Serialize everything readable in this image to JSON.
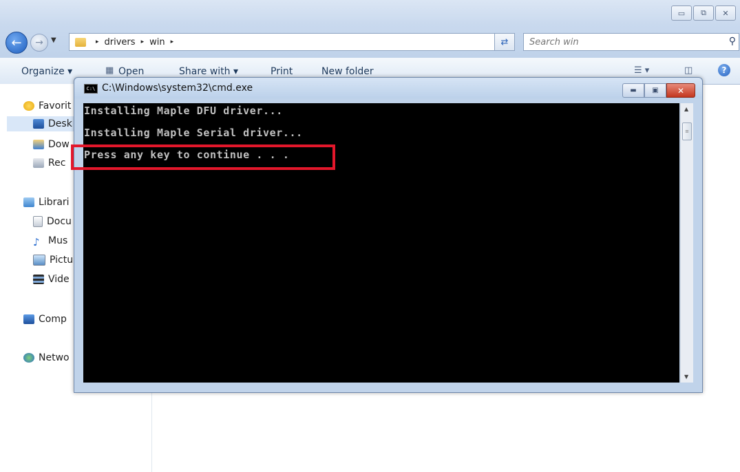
{
  "window_controls": {
    "minimize": "▭",
    "restore": "⧉",
    "close": "✕"
  },
  "address_bar": {
    "crumbs": [
      "drivers",
      "win"
    ],
    "separator": "▸",
    "dropdown": "▾"
  },
  "search": {
    "placeholder": "Search win",
    "icon": "search-icon"
  },
  "toolbar": {
    "organize": "Organize ▾",
    "open": "Open",
    "share_with": "Share with ▾",
    "print": "Print",
    "new_folder": "New folder",
    "help": "?"
  },
  "nav_pane": {
    "favorites": "Favorit",
    "desktop": "Desk",
    "downloads": "Dow",
    "recent": "Rec",
    "libraries": "Librari",
    "documents": "Docu",
    "music": "Mus",
    "pictures": "Pictu",
    "videos": "Vide",
    "computer": "Comp",
    "network": "Netwo"
  },
  "cmd_window": {
    "icon_text": "C:\\",
    "title": "C:\\Windows\\system32\\cmd.exe",
    "buttons": {
      "minimize": "▬",
      "maximize": "▣",
      "close": "✕"
    },
    "lines": [
      "Installing Maple DFU driver...",
      "Installing Maple Serial driver...",
      "Press any key to continue . . ."
    ]
  },
  "colors": {
    "highlight": "#e3172b",
    "console_bg": "#000000",
    "console_text": "#c0c0c0"
  }
}
